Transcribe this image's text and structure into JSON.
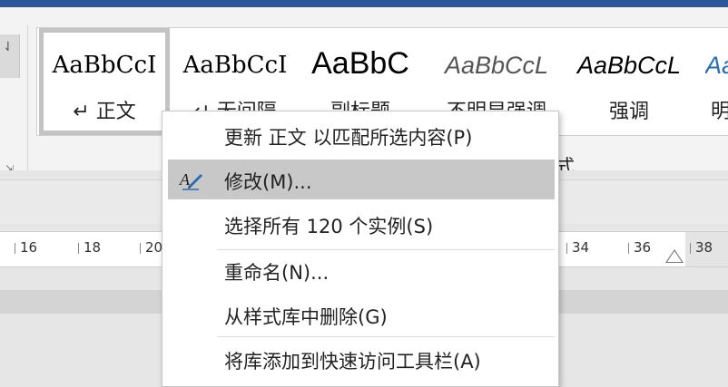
{
  "ribbon": {
    "section_label": "式",
    "styles": [
      {
        "sample": "AaBbCcI",
        "name": "↵ 正文",
        "selected": true
      },
      {
        "sample": "AaBbCcI",
        "name": "↵ 无间隔"
      },
      {
        "sample": "AaBbC",
        "name": "副标题"
      },
      {
        "sample": "AaBbCcL",
        "name": "不明显强调"
      },
      {
        "sample": "AaBbCcL",
        "name": "强调"
      },
      {
        "sample": "Aa",
        "name": "明"
      }
    ]
  },
  "ruler": {
    "ticks_left": [
      "16",
      "18",
      "20"
    ],
    "ticks_right": [
      "34",
      "36",
      "38"
    ]
  },
  "context_menu": {
    "items": [
      {
        "label": "更新 正文 以匹配所选内容(P)",
        "icon": null
      },
      {
        "label": "修改(M)...",
        "icon": "pen-icon",
        "highlighted": true
      },
      {
        "label": "选择所有 120 个实例(S)",
        "icon": null
      },
      {
        "label": "重命名(N)...",
        "icon": null
      },
      {
        "label": "从样式库中删除(G)",
        "icon": null
      },
      {
        "label": "将库添加到快速访问工具栏(A)",
        "icon": null
      }
    ]
  },
  "colors": {
    "accent": "#2b579a",
    "highlight": "#c8c8c8",
    "pen_blue": "#2b6cb0"
  }
}
